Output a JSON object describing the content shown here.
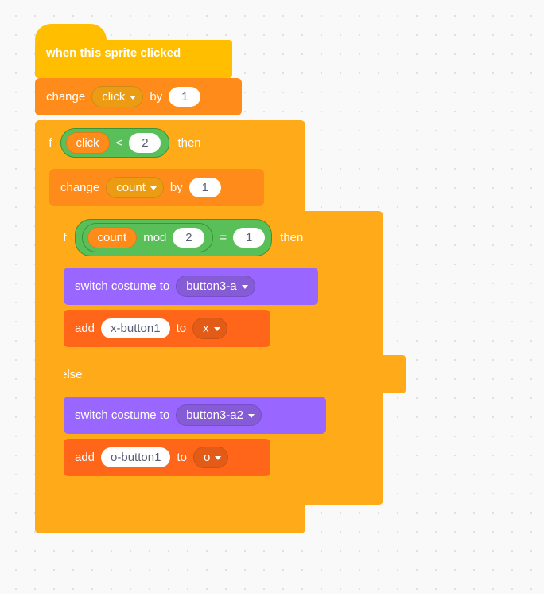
{
  "hat": {
    "label": "when this sprite clicked"
  },
  "change1": {
    "word_change": "change",
    "var": "click",
    "word_by": "by",
    "value": "1"
  },
  "if1": {
    "word_if": "if",
    "word_then": "then",
    "op": {
      "left_var": "click",
      "operator": "<",
      "right": "2"
    }
  },
  "change2": {
    "word_change": "change",
    "var": "count",
    "word_by": "by",
    "value": "1"
  },
  "if2": {
    "word_if": "if",
    "word_then": "then",
    "outer_op": "=",
    "outer_right": "1",
    "inner": {
      "left_var": "count",
      "op_word": "mod",
      "right": "2"
    }
  },
  "switch1": {
    "prefix": "switch costume to",
    "costume": "button3-a"
  },
  "add1": {
    "word_add": "add",
    "item": "x-button1",
    "word_to": "to",
    "list": "x"
  },
  "else": {
    "label": "else"
  },
  "switch2": {
    "prefix": "switch costume to",
    "costume": "button3-a2"
  },
  "add2": {
    "word_add": "add",
    "item": "o-button1",
    "word_to": "to",
    "list": "o"
  }
}
